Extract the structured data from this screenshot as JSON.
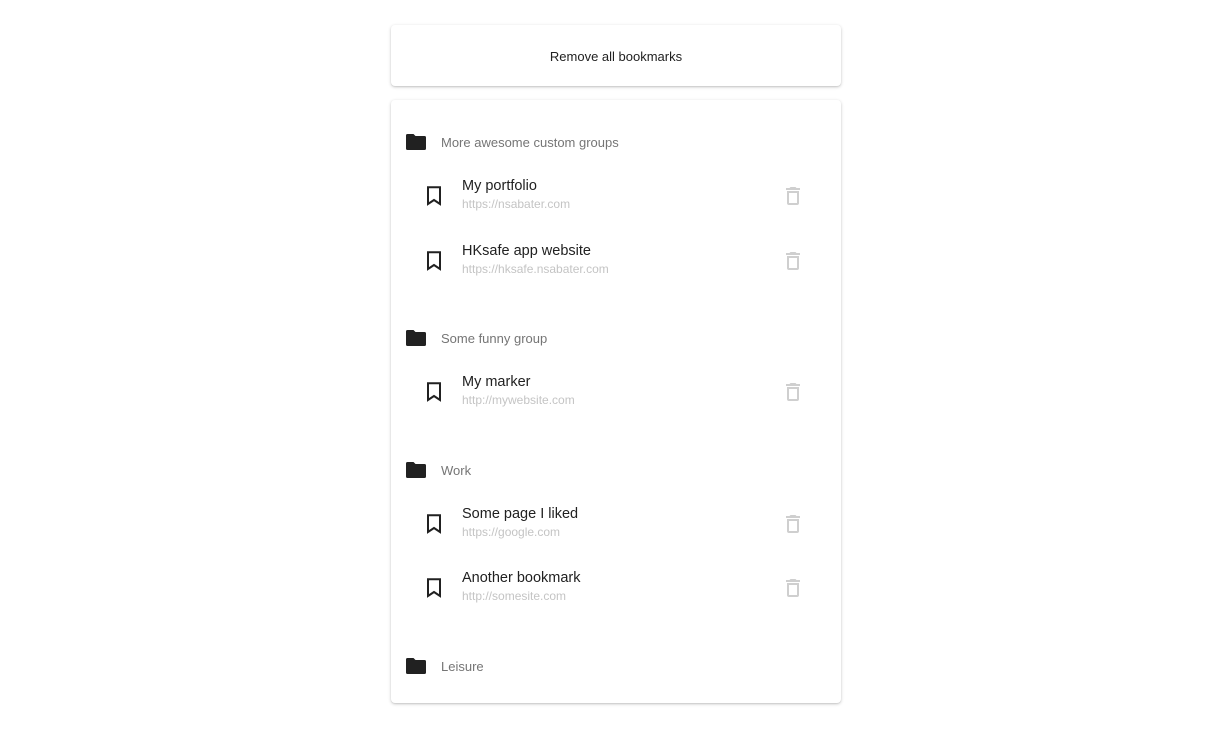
{
  "toolbar": {
    "remove_all_label": "Remove all bookmarks"
  },
  "colors": {
    "folder_icon": "#212121",
    "bookmark_icon": "#212121",
    "delete_icon": "#cfcfcf",
    "group_label": "#757575",
    "url_text": "#c4c4c4"
  },
  "icons": {
    "group": "folder-icon",
    "bookmark": "bookmark-border-icon",
    "delete": "trash-icon"
  },
  "groups": [
    {
      "name": "More awesome custom groups",
      "bookmarks": [
        {
          "title": "My portfolio",
          "url": "https://nsabater.com"
        },
        {
          "title": "HKsafe app website",
          "url": "https://hksafe.nsabater.com"
        }
      ]
    },
    {
      "name": "Some funny group",
      "bookmarks": [
        {
          "title": "My marker",
          "url": "http://mywebsite.com"
        }
      ]
    },
    {
      "name": "Work",
      "bookmarks": [
        {
          "title": "Some page I liked",
          "url": "https://google.com"
        },
        {
          "title": "Another bookmark",
          "url": "http://somesite.com"
        }
      ]
    },
    {
      "name": "Leisure",
      "bookmarks": []
    }
  ]
}
